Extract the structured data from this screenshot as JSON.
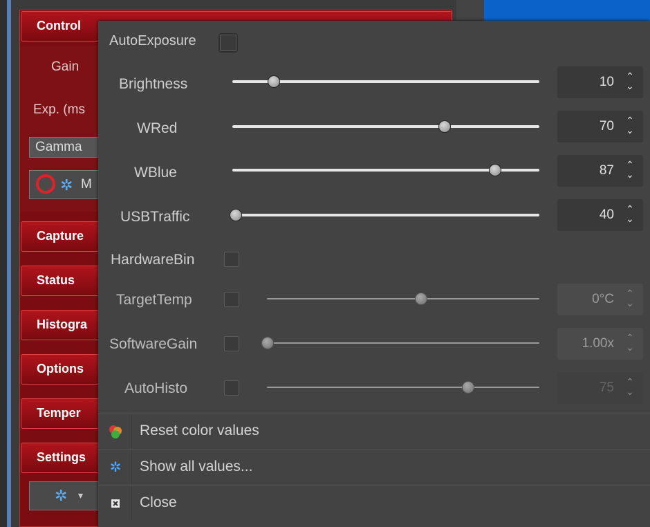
{
  "sidebar": {
    "sections": [
      {
        "label": "Control"
      },
      {
        "label": "Capture"
      },
      {
        "label": "Status"
      },
      {
        "label": "Histogra"
      },
      {
        "label": "Options"
      },
      {
        "label": "Temper"
      },
      {
        "label": "Settings"
      }
    ],
    "control_fields": {
      "gain_label": "Gain",
      "exp_label": "Exp. (ms",
      "gamma_label": "Gamma",
      "mode_label": "M"
    }
  },
  "popup": {
    "autoexposure_label": "AutoExposure",
    "sliders": [
      {
        "label": "Brightness",
        "value": "10",
        "level": 0.12
      },
      {
        "label": "WRed",
        "value": "70",
        "level": 0.7
      },
      {
        "label": "WBlue",
        "value": "87",
        "level": 0.87
      },
      {
        "label": "USBTraffic",
        "value": "40",
        "level": 0.0
      }
    ],
    "hardwarebin_label": "HardwareBin",
    "checked_sliders": [
      {
        "label": "TargetTemp",
        "value": "0°C",
        "level": 0.57
      },
      {
        "label": "SoftwareGain",
        "value": "1.00x",
        "level": 0.0
      },
      {
        "label": "AutoHisto",
        "value": "75",
        "level": 0.75
      }
    ],
    "menu": [
      {
        "label": "Reset color values",
        "icon": "color-balls-icon"
      },
      {
        "label": "Show all values...",
        "icon": "gear-icon"
      },
      {
        "label": "Close",
        "icon": "close-box-icon"
      }
    ]
  },
  "colors": {
    "panel_red": "#7a0c12",
    "popup_bg": "#434343",
    "accent_blue": "#0b63c9",
    "annotation_red": "#e3202a"
  }
}
